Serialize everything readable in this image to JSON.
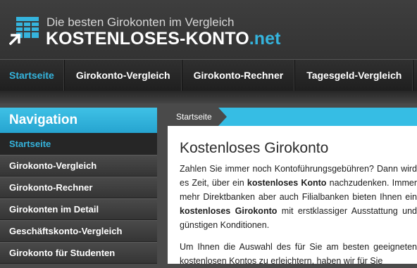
{
  "header": {
    "tagline": "Die besten Girokonten im Vergleich",
    "brand_main": "KOSTENLOSES-KONTO",
    "brand_tld": ".net"
  },
  "topnav": {
    "tabs": [
      {
        "label": "Startseite",
        "active": true
      },
      {
        "label": "Girokonto-Vergleich"
      },
      {
        "label": "Girokonto-Rechner"
      },
      {
        "label": "Tagesgeld-Vergleich"
      }
    ]
  },
  "sidebar": {
    "title": "Navigation",
    "items": [
      {
        "label": "Startseite",
        "active": true
      },
      {
        "label": "Girokonto-Vergleich"
      },
      {
        "label": "Girokonto-Rechner"
      },
      {
        "label": "Girokonten im Detail"
      },
      {
        "label": "Geschäftskonto-Vergleich"
      },
      {
        "label": "Girokonto für Studenten"
      }
    ]
  },
  "main": {
    "breadcrumb": "Startseite",
    "title": "Kostenloses Girokonto",
    "p1": {
      "t1": "Zahlen Sie immer noch Kontoführungsgebühren? Dann wird es Zeit, über ein ",
      "b1": "kostenloses Konto",
      "t2": " nachzudenken. Immer mehr Direktbanken aber auch Filialbanken bieten Ihnen ein ",
      "b2": "kostenloses Girokonto",
      "t3": " mit erstklassiger Ausstattung und günstigen Konditionen."
    },
    "p2": "Um Ihnen die Auswahl des für Sie am besten geeigneten kostenlosen Kontos zu erleichtern, haben wir für Sie"
  },
  "colors": {
    "accent": "#35b4dd",
    "header_bg": "#3a3a3a",
    "nav_bg": "#2a2a2a"
  }
}
